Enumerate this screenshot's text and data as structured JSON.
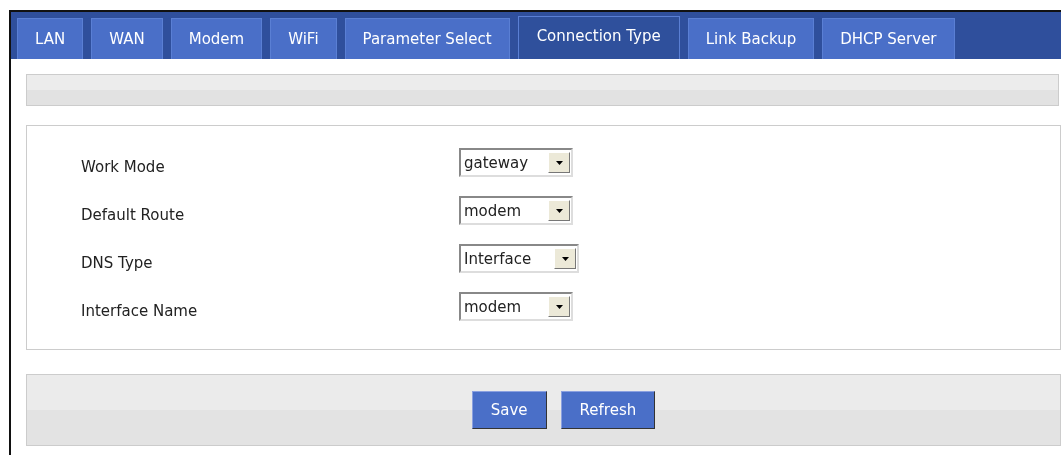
{
  "tabs": [
    {
      "label": "LAN",
      "selected": false
    },
    {
      "label": "WAN",
      "selected": false
    },
    {
      "label": "Modem",
      "selected": false
    },
    {
      "label": "WiFi",
      "selected": false
    },
    {
      "label": "Parameter Select",
      "selected": false
    },
    {
      "label": "Connection Type",
      "selected": true
    },
    {
      "label": "Link Backup",
      "selected": false
    },
    {
      "label": "DHCP Server",
      "selected": false
    }
  ],
  "fields": [
    {
      "label": "Work Mode",
      "value": "gateway"
    },
    {
      "label": "Default Route",
      "value": "modem"
    },
    {
      "label": "DNS Type",
      "value": "Interface"
    },
    {
      "label": "Interface Name",
      "value": "modem"
    }
  ],
  "buttons": [
    "Save",
    "Refresh"
  ]
}
